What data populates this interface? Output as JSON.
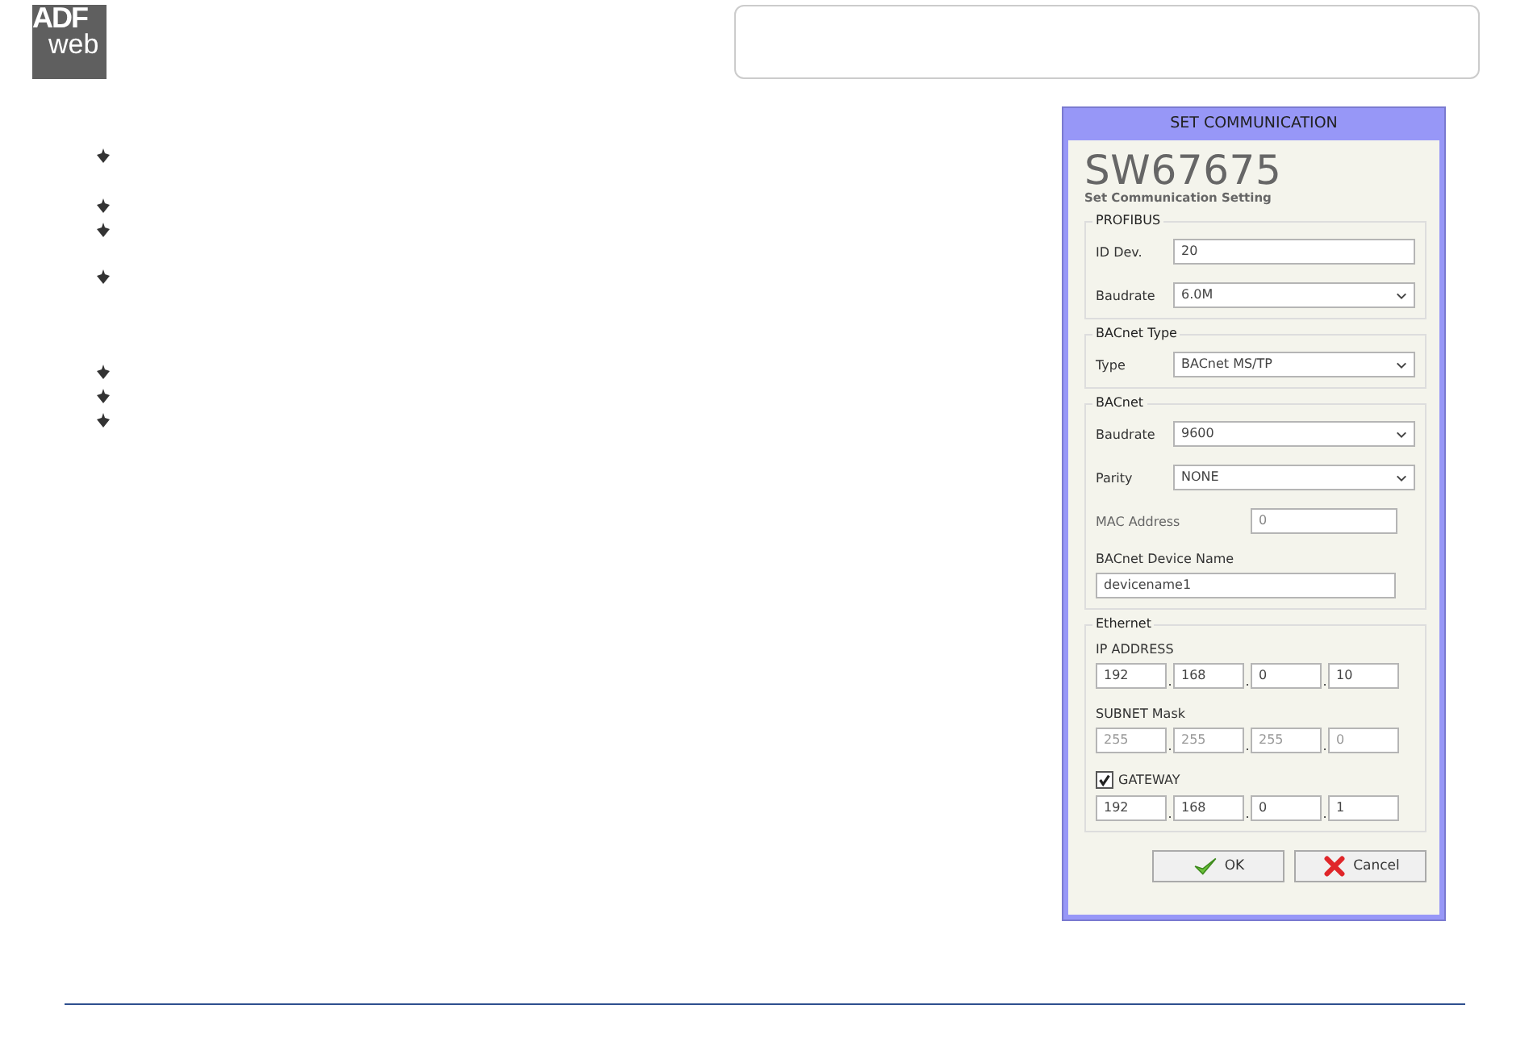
{
  "logo": {
    "top": "ADF",
    "bottom": "web"
  },
  "dialog": {
    "title": "SET COMMUNICATION",
    "product": "SW67675",
    "subtitle": "Set Communication Setting",
    "groups": [
      {
        "title": "PROFIBUS",
        "rows": [
          {
            "kind": "text",
            "label": "ID Dev.",
            "value": "20"
          },
          {
            "kind": "select",
            "label": "Baudrate",
            "value": "6.0M"
          }
        ]
      },
      {
        "title": "BACnet Type",
        "rows": [
          {
            "kind": "select",
            "label": "Type",
            "value": "BACnet MS/TP"
          }
        ]
      },
      {
        "title": "BACnet",
        "rows": [
          {
            "kind": "select",
            "label": "Baudrate",
            "value": "9600"
          },
          {
            "kind": "select",
            "label": "Parity",
            "value": "NONE"
          },
          {
            "kind": "short",
            "label": "MAC Address",
            "value": "0"
          },
          {
            "kind": "stacked",
            "label": "BACnet Device Name",
            "value": "devicename1"
          }
        ]
      },
      {
        "title": "Ethernet",
        "rows": [
          {
            "kind": "ip",
            "label": "IP ADDRESS",
            "disabled": false,
            "octets": [
              "192",
              ".",
              "168",
              ".",
              "0",
              ".",
              "10"
            ]
          },
          {
            "kind": "ip",
            "label": "SUBNET Mask",
            "disabled": true,
            "octets": [
              "255",
              ".",
              "255",
              ".",
              "255",
              ".",
              "0"
            ]
          },
          {
            "kind": "checkip",
            "label": "GATEWAY",
            "checked": true,
            "disabled": false,
            "octets": [
              "192",
              ".",
              "168",
              ".",
              "0",
              ".",
              "1"
            ]
          }
        ]
      }
    ]
  },
  "buttons": [
    {
      "kind": "ok",
      "label": "OK"
    },
    {
      "kind": "cancel",
      "label": "Cancel"
    }
  ]
}
